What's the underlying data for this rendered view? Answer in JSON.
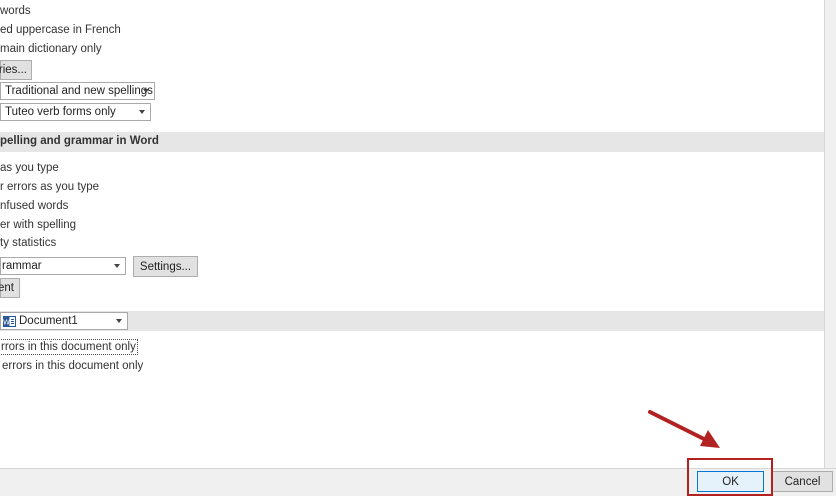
{
  "options": {
    "items_top": [
      "words",
      "ed uppercase in French",
      "main dictionary only"
    ],
    "dictionaries_button": "ries...",
    "french_modes_value": "Traditional and new spellings",
    "spanish_modes_value": "Tuteo verb forms only"
  },
  "word_section": {
    "title": "pelling and grammar in Word",
    "items": [
      "as you type",
      "r errors as you type",
      "nfused words",
      "er with spelling",
      "ty statistics"
    ],
    "writing_style_value": "rammar",
    "settings_button": "Settings...",
    "recheck_button": "ent"
  },
  "exceptions": {
    "document_value": "Document1",
    "items": [
      "rrors in this document only",
      "errors in this document only"
    ]
  },
  "footer": {
    "ok_label": "OK",
    "cancel_label": "Cancel"
  },
  "annotation": {
    "color": "#b22222"
  }
}
